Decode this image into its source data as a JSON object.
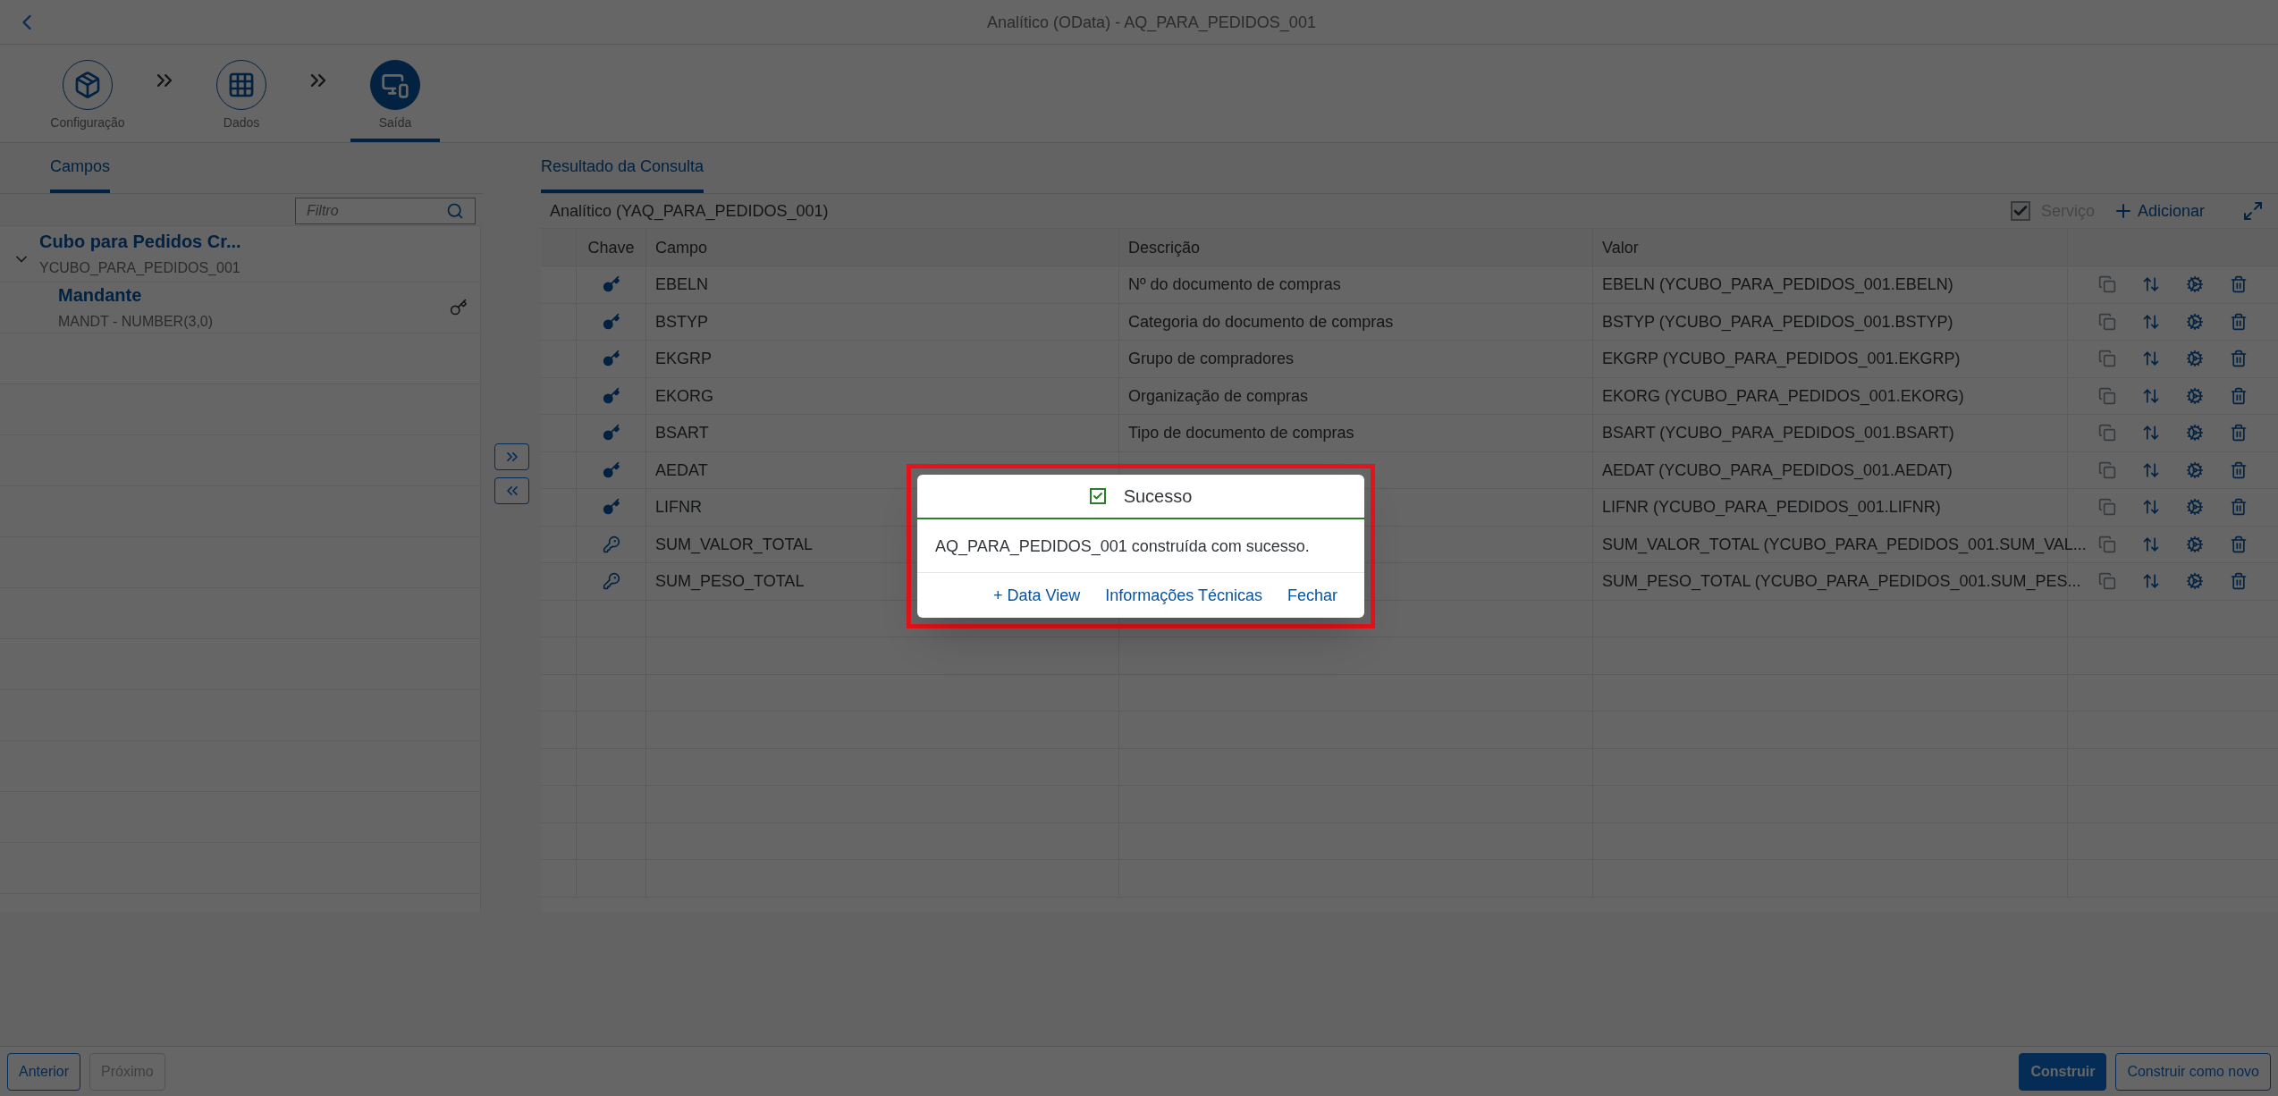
{
  "header": {
    "title": "Analítico (OData) - AQ_PARA_PEDIDOS_001"
  },
  "steps": [
    {
      "label": "Configuração",
      "selected": false
    },
    {
      "label": "Dados",
      "selected": false
    },
    {
      "label": "Saída",
      "selected": true
    }
  ],
  "left_panel": {
    "tab": {
      "label": "Campos",
      "selected": true
    },
    "filter": {
      "placeholder": "Filtro"
    },
    "tree": [
      {
        "title": "Cubo para Pedidos Cr...",
        "subtitle": "YCUBO_PARA_PEDIDOS_001",
        "expanded": true,
        "children": [
          {
            "title": "Mandante",
            "subtitle": "MANDT - NUMBER(3,0)",
            "key": true
          }
        ]
      }
    ]
  },
  "right_panel": {
    "tab": {
      "label": "Resultado da Consulta",
      "selected": true
    },
    "table_title": "Analítico (YAQ_PARA_PEDIDOS_001)",
    "service": {
      "label": "Serviço",
      "checked": true,
      "disabled": true
    },
    "add_button": "Adicionar",
    "columns": [
      "Chave",
      "Campo",
      "Descrição",
      "Valor"
    ],
    "rows": [
      {
        "key": true,
        "field": "EBELN",
        "description": "Nº do documento de compras",
        "value": "EBELN (YCUBO_PARA_PEDIDOS_001.EBELN)"
      },
      {
        "key": true,
        "field": "BSTYP",
        "description": "Categoria do documento de compras",
        "value": "BSTYP (YCUBO_PARA_PEDIDOS_001.BSTYP)"
      },
      {
        "key": true,
        "field": "EKGRP",
        "description": "Grupo de compradores",
        "value": "EKGRP (YCUBO_PARA_PEDIDOS_001.EKGRP)"
      },
      {
        "key": true,
        "field": "EKORG",
        "description": "Organização de compras",
        "value": "EKORG (YCUBO_PARA_PEDIDOS_001.EKORG)"
      },
      {
        "key": true,
        "field": "BSART",
        "description": "Tipo de documento de compras",
        "value": "BSART (YCUBO_PARA_PEDIDOS_001.BSART)"
      },
      {
        "key": true,
        "field": "AEDAT",
        "value": "AEDAT (YCUBO_PARA_PEDIDOS_001.AEDAT)"
      },
      {
        "key": true,
        "field": "LIFNR",
        "value": "LIFNR (YCUBO_PARA_PEDIDOS_001.LIFNR)"
      },
      {
        "key": false,
        "field": "SUM_VALOR_TOTAL",
        "value": "SUM_VALOR_TOTAL (YCUBO_PARA_PEDIDOS_001.SUM_VAL..."
      },
      {
        "key": false,
        "field": "SUM_PESO_TOTAL",
        "value": "SUM_PESO_TOTAL (YCUBO_PARA_PEDIDOS_001.SUM_PES..."
      }
    ]
  },
  "dialog": {
    "title": "Sucesso",
    "message": "AQ_PARA_PEDIDOS_001 construída com sucesso.",
    "highlighted": true,
    "actions": [
      "+ Data View",
      "Informações Técnicas",
      "Fechar"
    ]
  },
  "footer": {
    "left_buttons": [
      {
        "label": "Anterior",
        "kind": "default",
        "disabled": false
      },
      {
        "label": "Próximo",
        "kind": "default",
        "disabled": true
      }
    ],
    "right_buttons": [
      {
        "label": "Construir",
        "kind": "emphasized",
        "disabled": false
      },
      {
        "label": "Construir como novo",
        "kind": "default",
        "disabled": false
      }
    ]
  }
}
